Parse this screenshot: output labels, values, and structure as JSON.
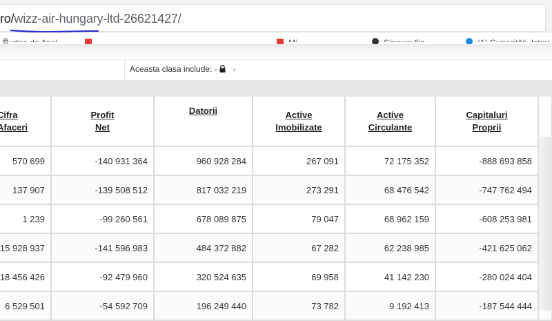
{
  "browser": {
    "url_prefix": "ro/",
    "url_slug": "wizz-air-hungary-ltd-26621427/",
    "annotation_color": "#2b2bd0"
  },
  "bookmarks": [
    {
      "label": "Curtea de Apel",
      "icon": "doc-icon"
    },
    {
      "label": "",
      "icon": "red-bookmark-icon"
    },
    {
      "label": "Mi...",
      "icon": "red-bookmark-icon"
    },
    {
      "label": "Singura fiic...",
      "icon": "circle-icon"
    },
    {
      "label": "(1) Curiozități, Istori...",
      "icon": "blue-circle-icon"
    }
  ],
  "class_info": {
    "text": "Aceasta clasa include: -",
    "after": "-",
    "icon": "lock-icon"
  },
  "table": {
    "columns": [
      {
        "line1": "Cifra",
        "line2": "Afaceri"
      },
      {
        "line1": "Profit",
        "line2": "Net"
      },
      {
        "line1": "Datorii",
        "line2": ""
      },
      {
        "line1": "Active",
        "line2": "Imobilizate"
      },
      {
        "line1": "Active",
        "line2": "Circulante"
      },
      {
        "line1": "Capitaluri",
        "line2": "Proprii"
      }
    ],
    "rows": [
      [
        "570 699",
        "-140 931 364",
        "960 928 284",
        "267 091",
        "72 175 352",
        "-888 693 858"
      ],
      [
        "137 907",
        "-139 508 512",
        "817 032 219",
        "273 291",
        "68 476 542",
        "-747 762 494"
      ],
      [
        "1 239",
        "-99 260 561",
        "678 089 875",
        "79 047",
        "68 962 159",
        "-608 253 981"
      ],
      [
        "15 928 937",
        "-141 596 983",
        "484 372 882",
        "67 282",
        "62 238 985",
        "-421 625 062"
      ],
      [
        "18 456 426",
        "-92 479 960",
        "320 524 635",
        "69 958",
        "41 142 230",
        "-280 024 404"
      ],
      [
        "6 529 501",
        "-54 592 709",
        "196 249 440",
        "73 782",
        "9 192 413",
        "-187 544 444"
      ]
    ]
  }
}
